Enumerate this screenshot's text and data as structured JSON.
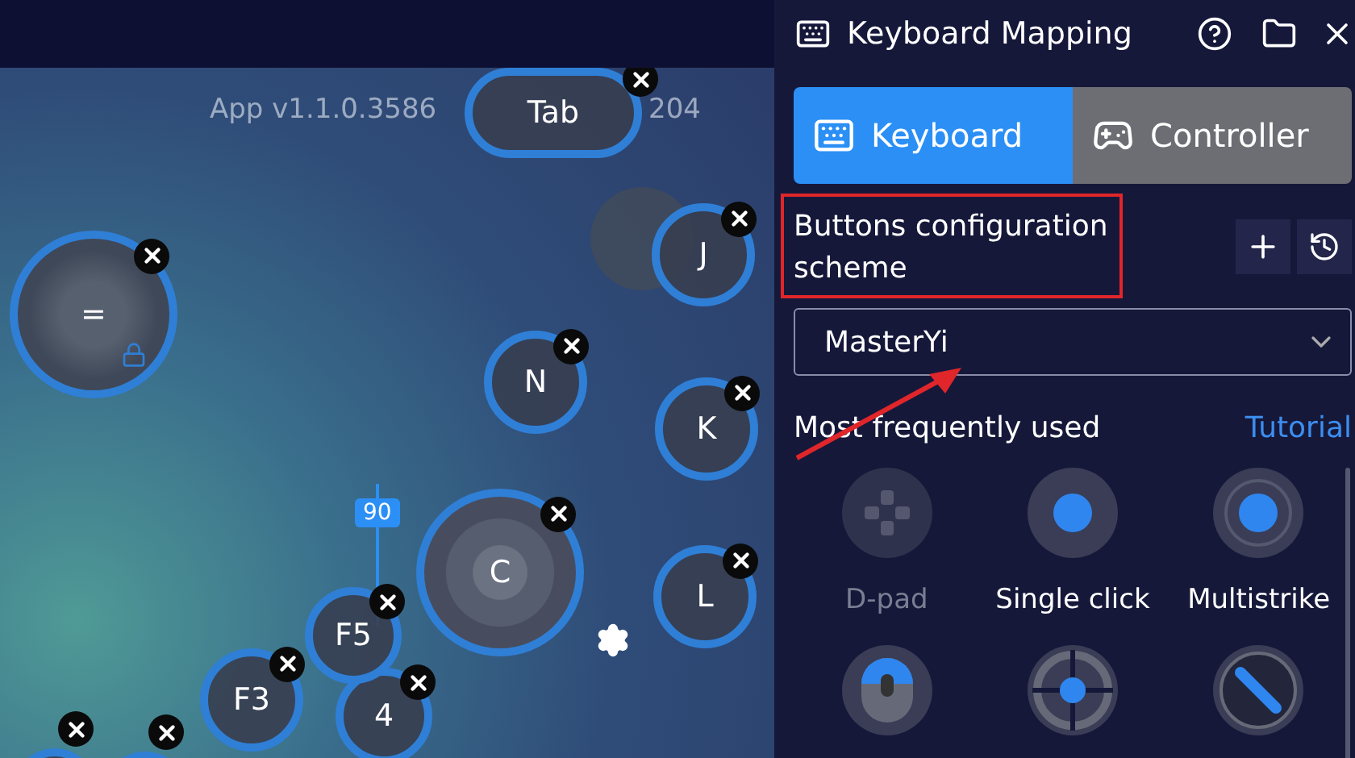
{
  "canvas": {
    "version_text": "App v1.1.0.3586",
    "version_tail": "204",
    "angle_badge": "90",
    "keys": [
      {
        "label": "Tab",
        "kind": "pill"
      },
      {
        "label": "=",
        "kind": "joystick",
        "locked": true
      },
      {
        "label": "J",
        "kind": "key"
      },
      {
        "label": "N",
        "kind": "key"
      },
      {
        "label": "K",
        "kind": "key"
      },
      {
        "label": "C",
        "kind": "skill"
      },
      {
        "label": "L",
        "kind": "key"
      },
      {
        "label": "F3",
        "kind": "key"
      },
      {
        "label": "4",
        "kind": "key"
      },
      {
        "label": "F5",
        "kind": "key"
      },
      {
        "kind": "partial"
      },
      {
        "kind": "partial"
      }
    ]
  },
  "panel": {
    "title": "Keyboard Mapping",
    "tabs": [
      {
        "label": "Keyboard",
        "kind": "keyboard",
        "selected": true
      },
      {
        "label": "Controller",
        "kind": "controller",
        "selected": false
      }
    ],
    "scheme_label": "Buttons configuration scheme",
    "scheme_value": "MasterYi",
    "section_title": "Most frequently used",
    "tutorial_link": "Tutorial",
    "tools": [
      {
        "label": "D-pad",
        "kind": "dpad",
        "disabled": true
      },
      {
        "label": "Single click",
        "kind": "click",
        "disabled": false
      },
      {
        "label": "Multistrike",
        "kind": "multi",
        "disabled": false
      },
      {
        "kind": "mouse",
        "disabled": false
      },
      {
        "kind": "aim",
        "disabled": false
      },
      {
        "kind": "fire",
        "disabled": false
      }
    ]
  }
}
